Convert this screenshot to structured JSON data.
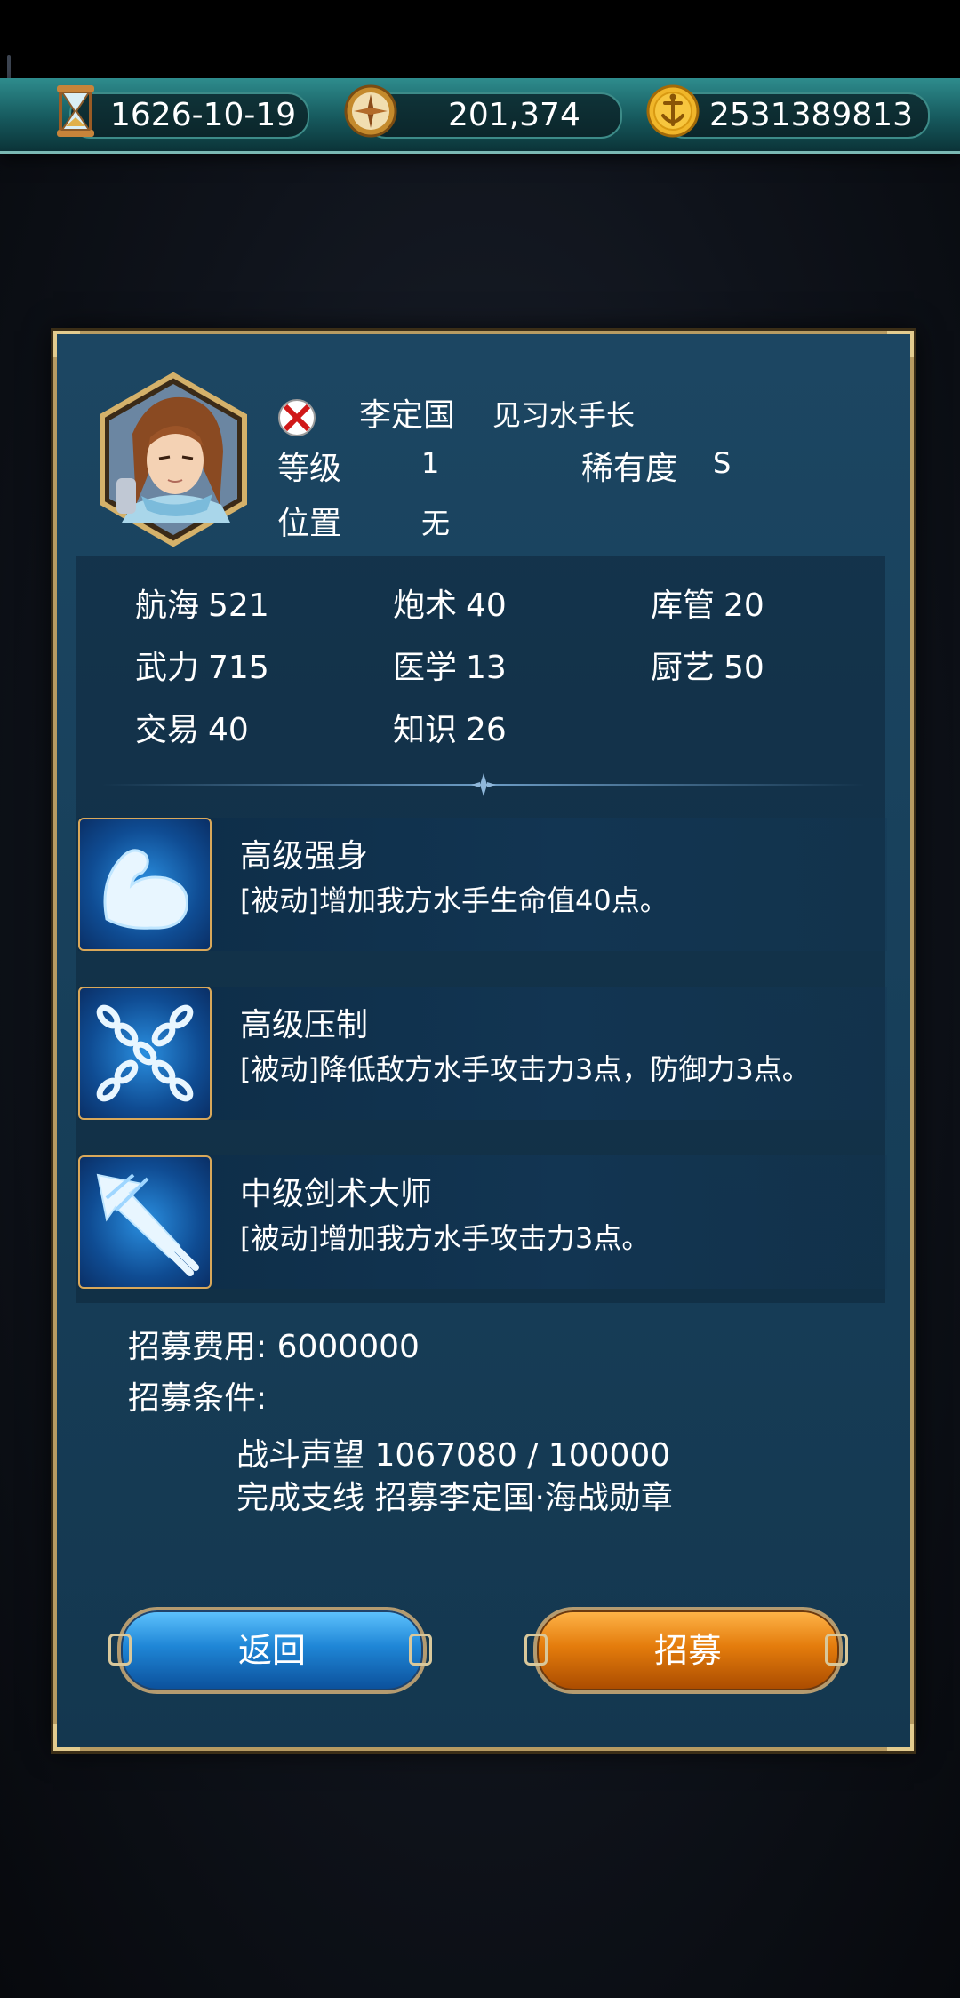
{
  "resources": {
    "date": "1626-10-19",
    "compass_value": "201,374",
    "gold": "2531389813"
  },
  "officer": {
    "name": "李定国",
    "title": "见习水手长",
    "level_label": "等级",
    "level_value": "1",
    "rarity_label": "稀有度",
    "rarity_value": "S",
    "position_label": "位置",
    "position_value": "无"
  },
  "stats": [
    {
      "label": "航海",
      "value": "521"
    },
    {
      "label": "炮术",
      "value": "40"
    },
    {
      "label": "库管",
      "value": "20"
    },
    {
      "label": "武力",
      "value": "715"
    },
    {
      "label": "医学",
      "value": "13"
    },
    {
      "label": "厨艺",
      "value": "50"
    },
    {
      "label": "交易",
      "value": "40"
    },
    {
      "label": "知识",
      "value": "26"
    }
  ],
  "skills": [
    {
      "name": "高级强身",
      "desc": "[被动]增加我方水手生命值40点。",
      "icon": "muscle-icon"
    },
    {
      "name": "高级压制",
      "desc": "[被动]降低敌方水手攻击力3点，防御力3点。",
      "icon": "chains-icon"
    },
    {
      "name": "中级剑术大师",
      "desc": "[被动]增加我方水手攻击力3点。",
      "icon": "sword-icon"
    }
  ],
  "recruit": {
    "cost_label": "招募费用: 6000000",
    "conditions_label": "招募条件:",
    "condition1": "战斗声望 1067080 / 100000",
    "condition2": "完成支线 招募李定国·海战勋章"
  },
  "buttons": {
    "back": "返回",
    "recruit": "招募"
  },
  "colors": {
    "panel_bg": "#173f5a",
    "panel_border": "#b79b62",
    "back_button": "#1f86d6",
    "recruit_button": "#e47c0c",
    "resource_bar": "#16595d"
  }
}
